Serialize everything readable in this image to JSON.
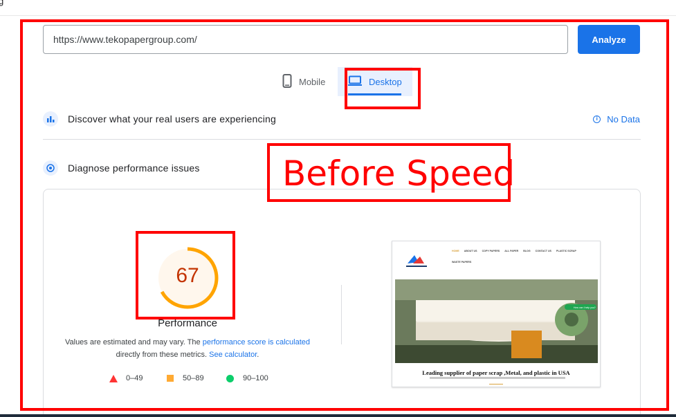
{
  "page": {
    "corner_glyph": "g"
  },
  "search": {
    "url_value": "https://www.tekopapergroup.com/",
    "analyze_label": "Analyze"
  },
  "tabs": [
    {
      "label": "Mobile",
      "icon": "phone-icon",
      "selected": false
    },
    {
      "label": "Desktop",
      "icon": "laptop-icon",
      "selected": true
    }
  ],
  "sections": {
    "field_data": {
      "title": "Discover what your real users are experiencing",
      "status": "No Data",
      "icon": "users-chart-icon"
    },
    "lab_data": {
      "title": "Diagnose performance issues",
      "icon": "diagnose-icon"
    }
  },
  "score": {
    "value": "67",
    "fraction": 0.67,
    "label": "Performance",
    "color": "#ffa400",
    "text_color": "#c33300",
    "note_part1": "Values are estimated and may vary. The ",
    "note_link1": "performance score is calculated",
    "note_part2": "directly from these metrics. ",
    "note_link2": "See calculator",
    "note_end": "."
  },
  "legend": [
    {
      "range": "0–49",
      "shape": "triangle",
      "color": "#ff3333"
    },
    {
      "range": "50–89",
      "shape": "square",
      "color": "#ffaa33"
    },
    {
      "range": "90–100",
      "shape": "circle",
      "color": "#0cce6b"
    }
  ],
  "screenshot": {
    "nav_items": [
      "HOME",
      "ABOUT US",
      "COPY PAPERS",
      "ALL PAPER",
      "BLOG",
      "CONTACT US",
      "PLASTIC SCRAP"
    ],
    "nav_item_2": "WASTE PAPERS",
    "chat_label": "How can I help you?",
    "heading": "Leading supplier of paper scrap ,Metal, and plastic in USA"
  },
  "annotation": {
    "text": "Before Speed",
    "color": "#ff0000"
  }
}
